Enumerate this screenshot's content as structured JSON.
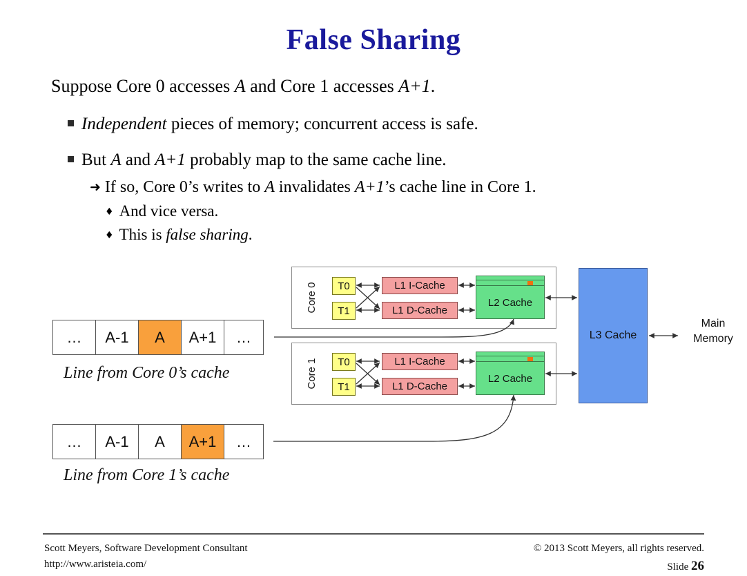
{
  "slide": {
    "title": "False Sharing"
  },
  "body": {
    "line1": {
      "pre": "Suppose Core 0 accesses ",
      "em1": "A",
      "mid": " and Core 1 accesses ",
      "em2": "A+1",
      "post": "."
    },
    "line2": {
      "bullet": "■",
      "em1": "Independent",
      "post": " pieces of memory; concurrent access is safe."
    },
    "line3": {
      "bullet": "■",
      "pre": "But ",
      "em1": "A",
      "mid": " and ",
      "em2": "A+1",
      "post": " probably map to the same cache line."
    },
    "line4": {
      "bullet": "➜",
      "pre": "If so, Core 0’s writes to ",
      "em1": "A",
      "mid": " invalidates ",
      "em2": "A+1",
      "post": "’s cache line in Core 1."
    },
    "line5": {
      "bullet": "♦",
      "text": "And vice versa."
    },
    "line6": {
      "bullet": "♦",
      "pre": "This is ",
      "em1": "false sharing",
      "post": "."
    }
  },
  "cache_lines": [
    {
      "id": "core0",
      "cells": [
        "…",
        "A-1",
        "A",
        "A+1",
        "…"
      ],
      "highlight_index": 2,
      "caption": "Line from Core 0’s cache"
    },
    {
      "id": "core1",
      "cells": [
        "…",
        "A-1",
        "A",
        "A+1",
        "…"
      ],
      "highlight_index": 3,
      "caption": "Line from Core 1’s cache"
    }
  ],
  "cores": [
    {
      "label": "Core 0",
      "threads": [
        "T0",
        "T1"
      ],
      "l1_caches": [
        "L1 I-Cache",
        "L1 D-Cache"
      ],
      "l2_label": "L2 Cache"
    },
    {
      "label": "Core 1",
      "threads": [
        "T0",
        "T1"
      ],
      "l1_caches": [
        "L1 I-Cache",
        "L1 D-Cache"
      ],
      "l2_label": "L2 Cache"
    }
  ],
  "memory": {
    "l3_label": "L3 Cache",
    "main_memory_line1": "Main",
    "main_memory_line2": "Memory"
  },
  "footer": {
    "left_line1": "Scott Meyers, Software Development Consultant",
    "left_line2": "http://www.aristeia.com/",
    "right_line1": "© 2013 Scott Meyers, all rights reserved.",
    "slide_word": "Slide ",
    "slide_number": "26"
  },
  "colors": {
    "title": "#1a1a9c",
    "highlight_orange": "#f9a03c",
    "thread_yellow": "#ffff88",
    "l1_pink": "#f4a0a0",
    "l2_green": "#66e08a",
    "l3_blue": "#6699ee",
    "marker_orange": "#f07010"
  }
}
